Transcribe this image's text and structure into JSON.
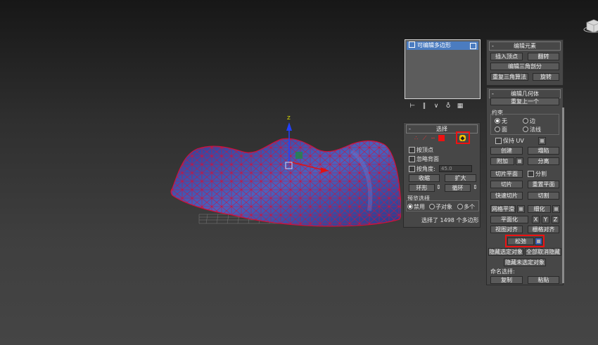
{
  "stack": {
    "modifier_label": "可编辑多边形"
  },
  "stack_tools": [
    "pin-stack-icon",
    "show-end-result-icon",
    "make-unique-icon",
    "remove-modifier-icon",
    "configure-modifier-sets-icon"
  ],
  "selection": {
    "title": "选择",
    "levels": [
      "vertex-level-icon",
      "edge-level-icon",
      "border-level-icon",
      "polygon-level-icon",
      "element-level-icon"
    ],
    "by_vertex": "按顶点",
    "ignore_backfacing": "忽略背面",
    "by_angle": "按角度:",
    "angle_value": "45.0",
    "shrink": "收缩",
    "grow": "扩大",
    "ring": "环形",
    "loop": "循环",
    "preview_label": "预览选择",
    "preview_options": [
      "禁用",
      "子对象",
      "多个"
    ],
    "status": "选择了 1498 个多边形"
  },
  "edit_elements": {
    "title": "编辑元素",
    "insert_vertex": "插入顶点",
    "flip": "翻转",
    "edit_triangulation": "编辑三角剖分",
    "retriangulate": "重复三角算法",
    "turn": "旋转"
  },
  "edit_geometry": {
    "title": "编辑几何体",
    "repeat_last": "重复上一个",
    "constraints_label": "约束",
    "constraint_options": [
      "无",
      "边",
      "面",
      "法线"
    ],
    "preserve_uvs": "保持 UV",
    "create": "创建",
    "collapse": "塌陷",
    "attach": "附加",
    "detach": "分离",
    "slice_plane": "切片平面",
    "split": "分割",
    "slice": "切片",
    "reset_plane": "重置平面",
    "quickslice": "快速切片",
    "cut": "切割",
    "meshsmooth": "网格平滑",
    "tessellate": "细化",
    "make_planar": "平面化",
    "x": "X",
    "y": "Y",
    "z": "Z",
    "view_align": "视图对齐",
    "grid_align": "栅格对齐",
    "relax": "松弛",
    "hide_selected": "隐藏选定对象",
    "unhide_all": "全部取消隐藏",
    "hide_unselected": "隐藏未选定对象",
    "named_selections": "命名选择:",
    "copy": "复制",
    "paste": "粘贴"
  },
  "viewport": {
    "gizmo_axis_label": "Z",
    "mesh_fill": "#3b4fa8",
    "wire_color": "#d0103a",
    "highlight_color": "#e11111"
  }
}
